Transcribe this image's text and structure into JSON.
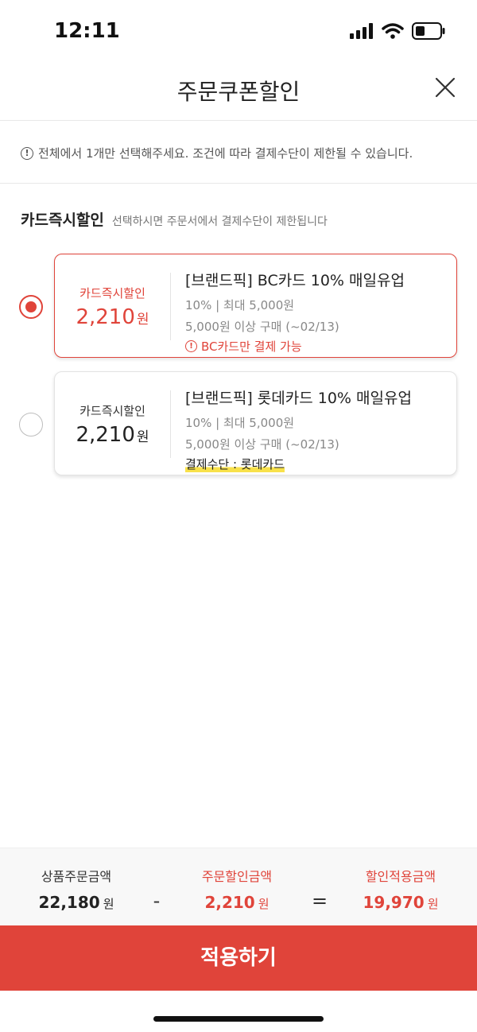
{
  "status_bar": {
    "time": "12:11"
  },
  "header": {
    "title": "주문쿠폰할인"
  },
  "notice": {
    "text": "전체에서 1개만 선택해주세요. 조건에 따라 결제수단이 제한될 수 있습니다."
  },
  "section": {
    "title": "카드즉시할인",
    "subtitle": "선택하시면 주문서에서 결제수단이 제한됩니다"
  },
  "coupons": [
    {
      "label": "카드즉시할인",
      "amount": "2,210",
      "won": "원",
      "title": "[브랜드픽] BC카드 10% 매일유업",
      "rate": "10% | 최대 5,000원",
      "condition": "5,000원 이상 구매 (~02/13)",
      "warning": "BC카드만 결제 가능",
      "selected": true
    },
    {
      "label": "카드즉시할인",
      "amount": "2,210",
      "won": "원",
      "title": "[브랜드픽] 롯데카드 10% 매일유업",
      "rate": "10% | 최대 5,000원",
      "condition": "5,000원 이상 구매 (~02/13)",
      "payment": "결제수단 : 롯데카드",
      "selected": false
    }
  ],
  "summary": {
    "product_label": "상품주문금액",
    "product_value": "22,180",
    "discount_label": "주문할인금액",
    "discount_value": "2,210",
    "final_label": "할인적용금액",
    "final_value": "19,970",
    "won": "원",
    "minus": "-",
    "equals": "="
  },
  "apply_button": {
    "label": "적용하기"
  },
  "colors": {
    "accent": "#e0443a",
    "highlight": "#f8e14a"
  }
}
